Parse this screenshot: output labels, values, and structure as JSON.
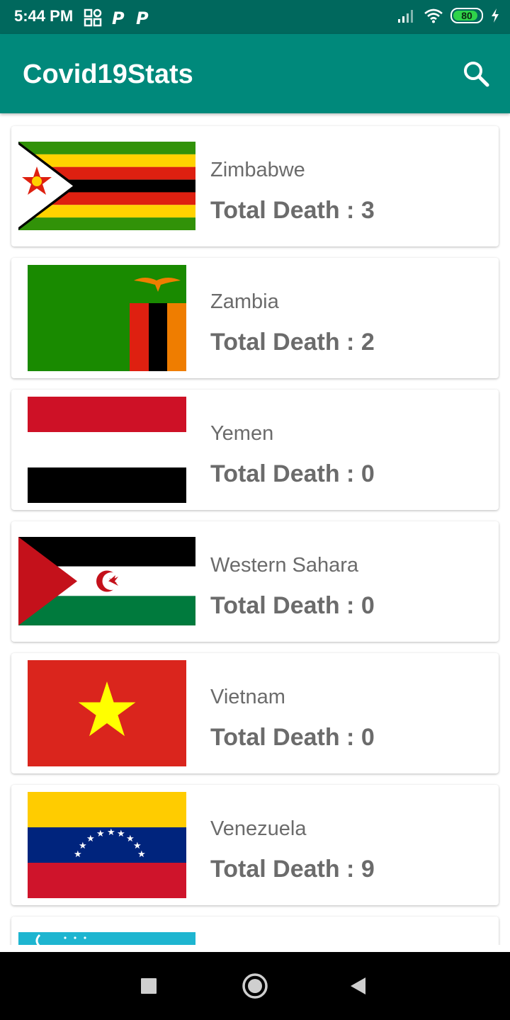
{
  "status_bar": {
    "time": "5:44 PM",
    "battery": "80",
    "icons": [
      "grid-icon",
      "p-icon",
      "p-icon",
      "signal-icon",
      "wifi-icon",
      "battery-icon",
      "charging-icon"
    ]
  },
  "app_bar": {
    "title": "Covid19Stats",
    "search_icon": "search-icon"
  },
  "countries": [
    {
      "name": "Zimbabwe",
      "death_text": "Total Death : 3"
    },
    {
      "name": "Zambia",
      "death_text": "Total Death : 2"
    },
    {
      "name": "Yemen",
      "death_text": "Total Death : 0"
    },
    {
      "name": "Western Sahara",
      "death_text": "Total Death : 0"
    },
    {
      "name": "Vietnam",
      "death_text": "Total Death : 0"
    },
    {
      "name": "Venezuela",
      "death_text": "Total Death : 9"
    }
  ],
  "nav_bar": {
    "icons": [
      "recents-icon",
      "home-icon",
      "back-icon"
    ]
  },
  "colors": {
    "status_bar": "#00685d",
    "app_bar": "#00897b",
    "text_gray": "#6b6b6b"
  }
}
